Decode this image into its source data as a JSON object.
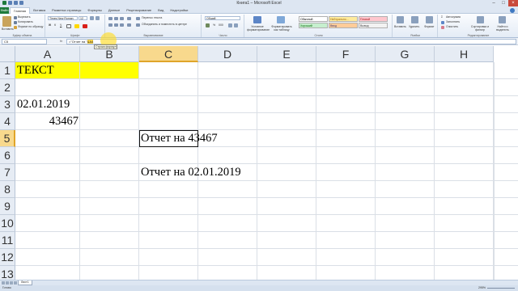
{
  "window": {
    "title": "Книга1 – Microsoft Excel"
  },
  "ribbon_tabs": [
    "Главная",
    "Вставка",
    "Разметка страницы",
    "Формулы",
    "Данные",
    "Рецензирование",
    "Вид",
    "Надстройки"
  ],
  "file_tab": "Файл",
  "ribbon": {
    "clipboard": {
      "name": "Буфер обмена",
      "paste": "Вставить",
      "cut": "Вырезать",
      "copy": "Копировать",
      "format_painter": "Формат по образцу"
    },
    "font": {
      "name": "Шрифт",
      "family": "Times New Roman",
      "size": "12"
    },
    "alignment": {
      "name": "Выравнивание",
      "wrap": "Перенос текста",
      "merge": "Объединить и поместить в центре"
    },
    "number": {
      "name": "Число",
      "format": "Общий"
    },
    "styles": {
      "name": "Стили",
      "conditional": "Условное форматирование",
      "as_table": "Форматировать как таблицу",
      "cell_styles": [
        {
          "label": "Обычный",
          "bg": "#ffffff",
          "color": "#000000"
        },
        {
          "label": "Нейтрально...",
          "bg": "#ffeb9c",
          "color": "#9c6500"
        },
        {
          "label": "Плохой",
          "bg": "#ffc7ce",
          "color": "#9c0006"
        },
        {
          "label": "Хороший",
          "bg": "#c6efce",
          "color": "#006100"
        },
        {
          "label": "Ввод",
          "bg": "#ffcc99",
          "color": "#3f3f76"
        },
        {
          "label": "Вывод",
          "bg": "#f2f2f2",
          "color": "#3f3f3f"
        }
      ]
    },
    "cells": {
      "name": "Ячейки",
      "insert": "Вставить",
      "delete": "Удалить",
      "format": "Формат"
    },
    "editing": {
      "name": "Редактирование",
      "autosum": "Автосумма",
      "fill": "Заполнить",
      "clear": "Очистить",
      "sort": "Сортировка и фильтр",
      "find": "Найти и выделить"
    }
  },
  "formula_bar": {
    "name_box": "C5",
    "fx": "fx",
    "formula_prefix": "=\"Отчет на \"",
    "formula_hl": "&A4",
    "formula_suffix": "",
    "tooltip": "Строка формул"
  },
  "grid": {
    "columns": [
      "A",
      "B",
      "C",
      "D",
      "E",
      "F",
      "G",
      "H"
    ],
    "active_column": "C",
    "rows": [
      "1",
      "2",
      "3",
      "4",
      "5",
      "6",
      "7",
      "8",
      "9",
      "10",
      "11",
      "12",
      "13"
    ],
    "active_row": "5",
    "cells": {
      "A1": "ТЕКСТ",
      "A3": "02.01.2019",
      "A4": "43467",
      "C5": "Отчет на 43467",
      "C7": "Отчет на 02.01.2019"
    },
    "highlight_color": "#ffff00"
  },
  "sheet_tab": "Лист1",
  "status": {
    "ready": "Готово",
    "zoom": "295%"
  }
}
